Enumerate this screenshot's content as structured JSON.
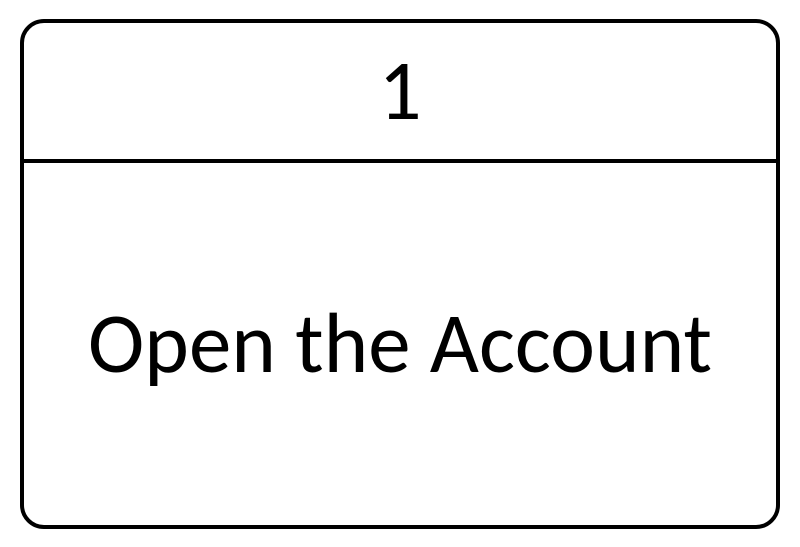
{
  "card": {
    "number": "1",
    "title": "Open the Account"
  }
}
